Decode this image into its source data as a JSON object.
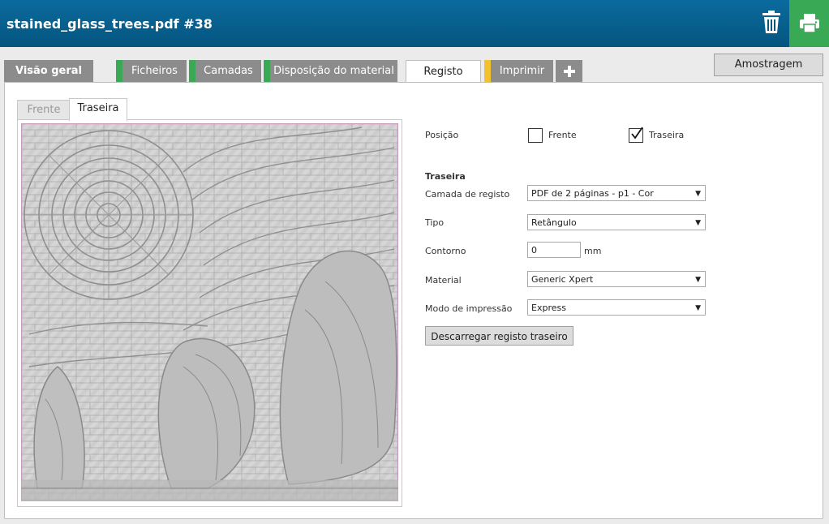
{
  "header": {
    "title": "stained_glass_trees.pdf #38",
    "colors": {
      "bar": "#04557f",
      "print": "#3aa956"
    }
  },
  "tabs": [
    {
      "label": "Visão geral",
      "status_color": ""
    },
    {
      "label": "Ficheiros",
      "status_color": "#3aa956"
    },
    {
      "label": "Camadas",
      "status_color": "#3aa956"
    },
    {
      "label": "Disposição do material",
      "status_color": "#3aa956"
    },
    {
      "label": "Registo",
      "status_color": ""
    },
    {
      "label": "Imprimir",
      "status_color": "#f2c12e"
    }
  ],
  "add_tab_icon": "plus-icon",
  "toolbar": {
    "sampling_label": "Amostragem"
  },
  "subtabs": [
    "Frente",
    "Traseira"
  ],
  "form": {
    "position_label": "Posição",
    "front_option": "Frente",
    "front_checked": false,
    "back_option": "Traseira",
    "back_checked": true,
    "section_title": "Traseira",
    "layer_label": "Camada de registo",
    "layer_value": "PDF de 2 páginas - p1 - Cor",
    "type_label": "Tipo",
    "type_value": "Retângulo",
    "contour_label": "Contorno",
    "contour_value": "0",
    "contour_unit": "mm",
    "material_label": "Material",
    "material_value": "Generic Xpert",
    "mode_label": "Modo de impressão",
    "mode_value": "Express",
    "download_label": "Descarregar registo traseiro"
  }
}
